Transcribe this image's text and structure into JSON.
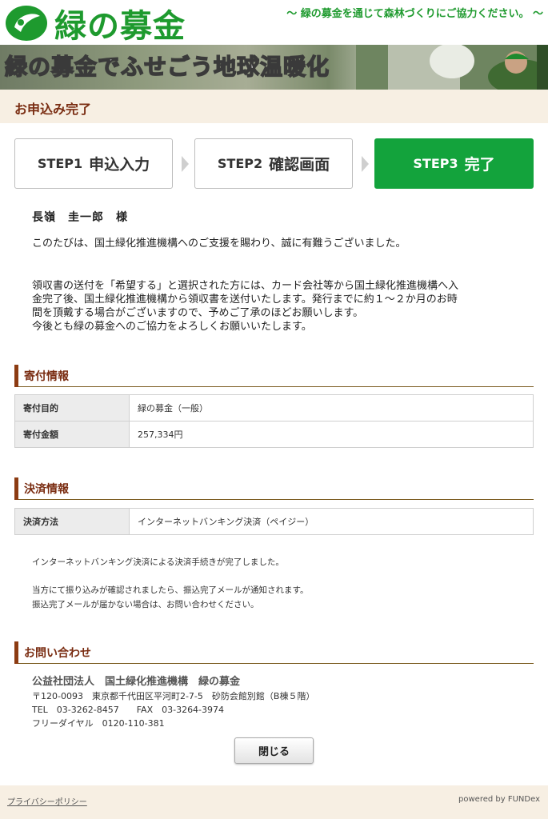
{
  "header": {
    "logo_text": "緑の募金",
    "tagline": "～ 緑の募金を通じて森林づくりにご協力ください。 ～",
    "banner_title": "緑の募金でふせごう地球温暖化"
  },
  "page_title": "お申込み完了",
  "steps": [
    {
      "num": "STEP1",
      "label": "申込入力"
    },
    {
      "num": "STEP2",
      "label": "確認画面"
    },
    {
      "num": "STEP3",
      "label": "完了"
    }
  ],
  "message": {
    "name": "長嶺　圭一郎　様",
    "thanks": "このたびは、国土緑化推進機構へのご支援を賜わり、誠に有難うございました。",
    "notice_lines": [
      "領収書の送付を「希望する」と選択された方には、カード会社等から国土緑化推進機構へ入",
      "金完了後、国土緑化推進機構から領収書を送付いたします。発行までに約１～２か月のお時",
      "間を頂戴する場合がございますので、予めご了承のほどお願いします。",
      "今後とも緑の募金へのご協力をよろしくお願いいたします。"
    ]
  },
  "donation": {
    "heading": "寄付情報",
    "rows": [
      {
        "key": "寄付目的",
        "value": "緑の募金（一般）"
      },
      {
        "key": "寄付金額",
        "value": "257,334円"
      }
    ]
  },
  "payment": {
    "heading": "決済情報",
    "rows": [
      {
        "key": "決済方法",
        "value": "インターネットバンキング決済（ペイジー）"
      }
    ],
    "note1": "インターネットバンキング決済による決済手続きが完了しました。",
    "note2": "当方にて振り込みが確認されましたら、振込完了メールが通知されます。",
    "note3": "振込完了メールが届かない場合は、お問い合わせください。"
  },
  "contact": {
    "heading": "お問い合わせ",
    "org": "公益社団法人　国土緑化推進機構　緑の募金",
    "address": "〒120-0093　東京都千代田区平河町2-7-5　砂防会館別館（B棟５階）",
    "tel_fax": "TEL　03-3262-8457　　FAX　03-3264-3974",
    "free_dial": "フリーダイヤル　0120-110-381"
  },
  "close_label": "閉じる",
  "footer": {
    "privacy": "プライバシーポリシー",
    "powered": "powered by FUNDex"
  },
  "colors": {
    "brand_green": "#1e9a2e",
    "active_step": "#13a33c",
    "section_brown": "#7a2d12",
    "beige_bar": "#f7efe3"
  }
}
